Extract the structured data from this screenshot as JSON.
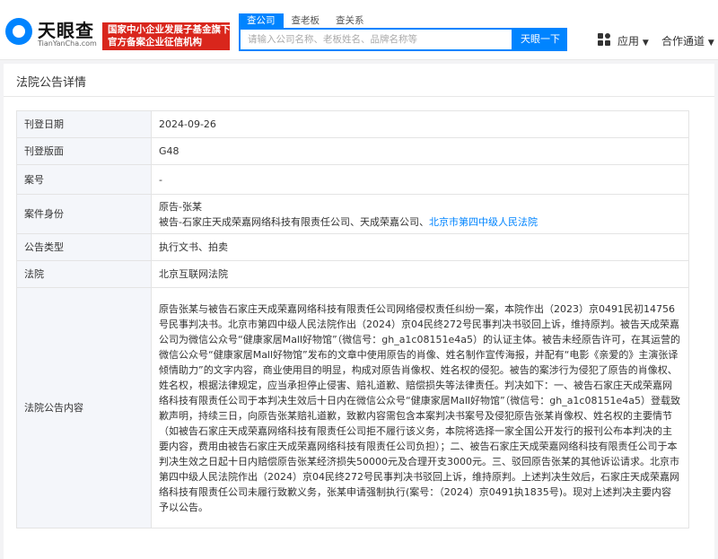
{
  "header": {
    "logo_text": "天眼查",
    "logo_url": "TianYanCha.com",
    "promo_line1": "国家中小企业发展子基金旗下",
    "promo_line2": "官方备案企业征信机构",
    "search_tabs": [
      "查公司",
      "查老板",
      "查关系"
    ],
    "search_placeholder": "请输入公司名称、老板姓名、品牌名称等",
    "search_button": "天眼一下",
    "nav_apps": "应用",
    "nav_partner": "合作通道",
    "accent_color": "#0084ff",
    "promo_color": "#d9261c"
  },
  "page": {
    "title": "法院公告详情"
  },
  "detail": {
    "rows": [
      {
        "label": "刊登日期",
        "value": "2024-09-26"
      },
      {
        "label": "刊登版面",
        "value": "G48"
      },
      {
        "label": "案号",
        "value": "-"
      },
      {
        "label": "案件身份",
        "value_line1": "原告-张某",
        "value_line2_prefix": "被告-石家庄天成荣嘉网络科技有限责任公司、天成荣嘉公司、",
        "value_line2_link": "北京市第四中级人民法院"
      },
      {
        "label": "公告类型",
        "value": "执行文书、拍卖"
      },
      {
        "label": "法院",
        "value": "北京互联网法院"
      },
      {
        "label": "法院公告内容",
        "value": "原告张某与被告石家庄天成荣嘉网络科技有限责任公司网络侵权责任纠纷一案，本院作出（2023）京0491民初14756号民事判决书。北京市第四中级人民法院作出（2024）京04民终272号民事判决书驳回上诉，维持原判。被告天成荣嘉公司为微信公众号“健康家居Mall好物馆”（微信号：gh_a1c08151e4a5）的认证主体。被告未经原告许可，在其运营的微信公众号“健康家居Mall好物馆”发布的文章中使用原告的肖像、姓名制作宣传海报，并配有“电影《亲爱的》主演张译倾情助力”的文字内容，商业使用目的明显，构成对原告肖像权、姓名权的侵犯。被告的案涉行为侵犯了原告的肖像权、姓名权，根据法律规定，应当承担停止侵害、赔礼道歉、赔偿损失等法律责任。判决如下：一、被告石家庄天成荣嘉网络科技有限责任公司于本判决生效后十日内在微信公众号“健康家居Mall好物馆”（微信号：gh_a1c08151e4a5）登载致歉声明，持续三日，向原告张某赔礼道歉，致歉内容需包含本案判决书案号及侵犯原告张某肖像权、姓名权的主要情节（如被告石家庄天成荣嘉网络科技有限责任公司拒不履行该义务，本院将选择一家全国公开发行的报刊公布本判决的主要内容，费用由被告石家庄天成荣嘉网络科技有限责任公司负担）；二、被告石家庄天成荣嘉网络科技有限责任公司于本判决生效之日起十日内赔偿原告张某经济损失50000元及合理开支3000元。三、驳回原告张某的其他诉讼请求。北京市第四中级人民法院作出（2024）京04民终272号民事判决书驳回上诉，维持原判。上述判决生效后，石家庄天成荣嘉网络科技有限责任公司未履行致歉义务，张某申请强制执行(案号：（2024）京0491执1835号)。现对上述判决主要内容予以公告。"
      }
    ]
  }
}
